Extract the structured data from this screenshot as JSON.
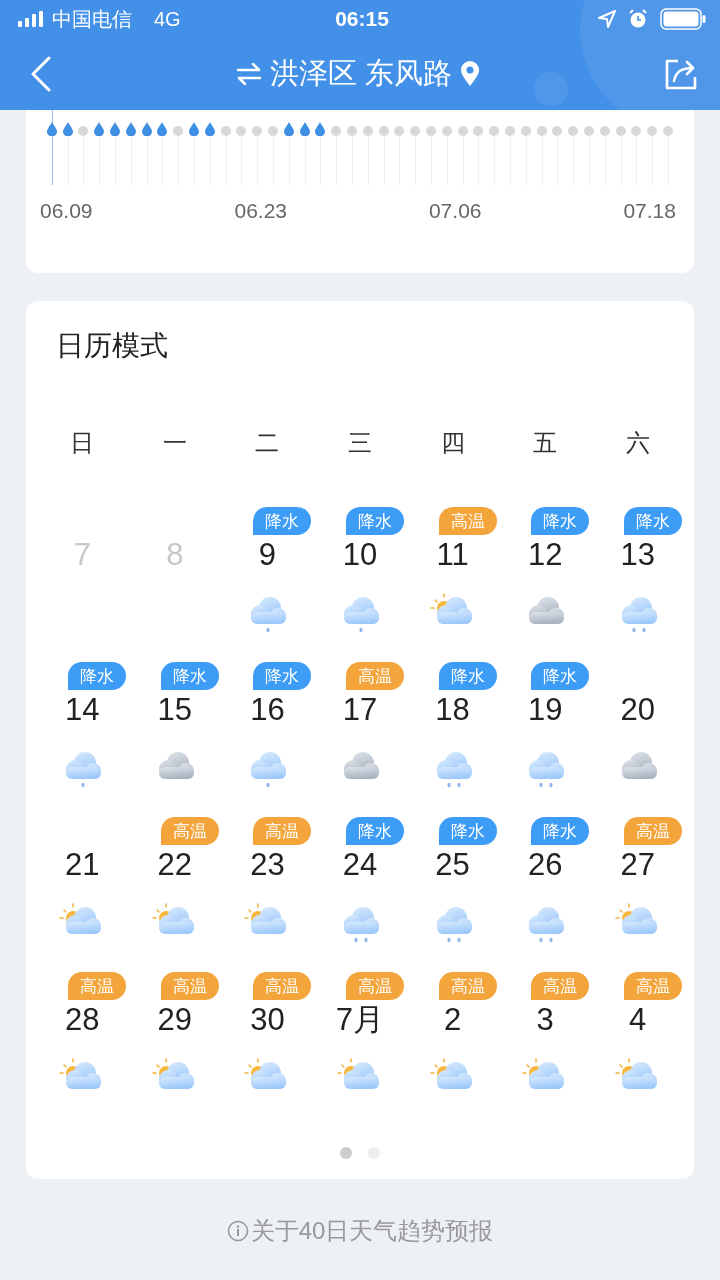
{
  "status_bar": {
    "carrier": "中国电信",
    "network": "4G",
    "time": "06:15"
  },
  "header": {
    "title": "洪泽区 东风路"
  },
  "precipitation_strip": {
    "days": [
      {
        "rain": true
      },
      {
        "rain": true
      },
      {
        "rain": false
      },
      {
        "rain": true
      },
      {
        "rain": true
      },
      {
        "rain": true
      },
      {
        "rain": true
      },
      {
        "rain": true
      },
      {
        "rain": false
      },
      {
        "rain": true
      },
      {
        "rain": true
      },
      {
        "rain": false
      },
      {
        "rain": false
      },
      {
        "rain": false
      },
      {
        "rain": false
      },
      {
        "rain": true
      },
      {
        "rain": true
      },
      {
        "rain": true
      },
      {
        "rain": false
      },
      {
        "rain": false
      },
      {
        "rain": false
      },
      {
        "rain": false
      },
      {
        "rain": false
      },
      {
        "rain": false
      },
      {
        "rain": false
      },
      {
        "rain": false
      },
      {
        "rain": false
      },
      {
        "rain": false
      },
      {
        "rain": false
      },
      {
        "rain": false
      },
      {
        "rain": false
      },
      {
        "rain": false
      },
      {
        "rain": false
      },
      {
        "rain": false
      },
      {
        "rain": false
      },
      {
        "rain": false
      },
      {
        "rain": false
      },
      {
        "rain": false
      },
      {
        "rain": false
      },
      {
        "rain": false
      }
    ],
    "date_labels": [
      "06.09",
      "06.23",
      "07.06",
      "07.18"
    ]
  },
  "calendar": {
    "title": "日历模式",
    "weekdays": [
      "日",
      "一",
      "二",
      "三",
      "四",
      "五",
      "六"
    ],
    "weeks": [
      [
        {
          "day": "7",
          "faded": true
        },
        {
          "day": "8",
          "faded": true
        },
        {
          "day": "9",
          "faded": false,
          "tag": {
            "label": "降水",
            "kind": "rain"
          },
          "icon": {
            "kind": "light_rain"
          }
        },
        {
          "day": "10",
          "faded": false,
          "tag": {
            "label": "降水",
            "kind": "rain"
          },
          "icon": {
            "kind": "light_rain"
          }
        },
        {
          "day": "11",
          "faded": false,
          "tag": {
            "label": "高温",
            "kind": "hot"
          },
          "icon": {
            "kind": "partly_cloudy"
          }
        },
        {
          "day": "12",
          "faded": false,
          "tag": {
            "label": "降水",
            "kind": "rain"
          },
          "icon": {
            "kind": "overcast"
          }
        },
        {
          "day": "13",
          "faded": false,
          "tag": {
            "label": "降水",
            "kind": "rain"
          },
          "icon": {
            "kind": "rain"
          }
        }
      ],
      [
        {
          "day": "14",
          "faded": false,
          "tag": {
            "label": "降水",
            "kind": "rain"
          },
          "icon": {
            "kind": "light_rain"
          }
        },
        {
          "day": "15",
          "faded": false,
          "tag": {
            "label": "降水",
            "kind": "rain"
          },
          "icon": {
            "kind": "overcast"
          }
        },
        {
          "day": "16",
          "faded": false,
          "tag": {
            "label": "降水",
            "kind": "rain"
          },
          "icon": {
            "kind": "light_rain"
          }
        },
        {
          "day": "17",
          "faded": false,
          "tag": {
            "label": "高温",
            "kind": "hot"
          },
          "icon": {
            "kind": "overcast"
          }
        },
        {
          "day": "18",
          "faded": false,
          "tag": {
            "label": "降水",
            "kind": "rain"
          },
          "icon": {
            "kind": "rain"
          }
        },
        {
          "day": "19",
          "faded": false,
          "tag": {
            "label": "降水",
            "kind": "rain"
          },
          "icon": {
            "kind": "rain"
          }
        },
        {
          "day": "20",
          "faded": false,
          "icon": {
            "kind": "overcast"
          }
        }
      ],
      [
        {
          "day": "21",
          "faded": false,
          "icon": {
            "kind": "partly_cloudy"
          }
        },
        {
          "day": "22",
          "faded": false,
          "tag": {
            "label": "高温",
            "kind": "hot"
          },
          "icon": {
            "kind": "partly_cloudy"
          }
        },
        {
          "day": "23",
          "faded": false,
          "tag": {
            "label": "高温",
            "kind": "hot"
          },
          "icon": {
            "kind": "partly_cloudy"
          }
        },
        {
          "day": "24",
          "faded": false,
          "tag": {
            "label": "降水",
            "kind": "rain"
          },
          "icon": {
            "kind": "rain"
          }
        },
        {
          "day": "25",
          "faded": false,
          "tag": {
            "label": "降水",
            "kind": "rain"
          },
          "icon": {
            "kind": "rain"
          }
        },
        {
          "day": "26",
          "faded": false,
          "tag": {
            "label": "降水",
            "kind": "rain"
          },
          "icon": {
            "kind": "rain"
          }
        },
        {
          "day": "27",
          "faded": false,
          "tag": {
            "label": "高温",
            "kind": "hot"
          },
          "icon": {
            "kind": "partly_cloudy"
          }
        }
      ],
      [
        {
          "day": "28",
          "faded": false,
          "tag": {
            "label": "高温",
            "kind": "hot"
          },
          "icon": {
            "kind": "partly_cloudy"
          }
        },
        {
          "day": "29",
          "faded": false,
          "tag": {
            "label": "高温",
            "kind": "hot"
          },
          "icon": {
            "kind": "partly_cloudy"
          }
        },
        {
          "day": "30",
          "faded": false,
          "tag": {
            "label": "高温",
            "kind": "hot"
          },
          "icon": {
            "kind": "partly_cloudy"
          }
        },
        {
          "day": "7月",
          "faded": false,
          "tag": {
            "label": "高温",
            "kind": "hot"
          },
          "icon": {
            "kind": "partly_cloudy"
          }
        },
        {
          "day": "2",
          "faded": false,
          "tag": {
            "label": "高温",
            "kind": "hot"
          },
          "icon": {
            "kind": "partly_cloudy"
          }
        },
        {
          "day": "3",
          "faded": false,
          "tag": {
            "label": "高温",
            "kind": "hot"
          },
          "icon": {
            "kind": "partly_cloudy"
          }
        },
        {
          "day": "4",
          "faded": false,
          "tag": {
            "label": "高温",
            "kind": "hot"
          },
          "icon": {
            "kind": "partly_cloudy"
          }
        }
      ]
    ],
    "pager": [
      {
        "selected": true
      },
      {
        "selected": false
      }
    ]
  },
  "footer": {
    "text": "关于40日天气趋势预报"
  }
}
